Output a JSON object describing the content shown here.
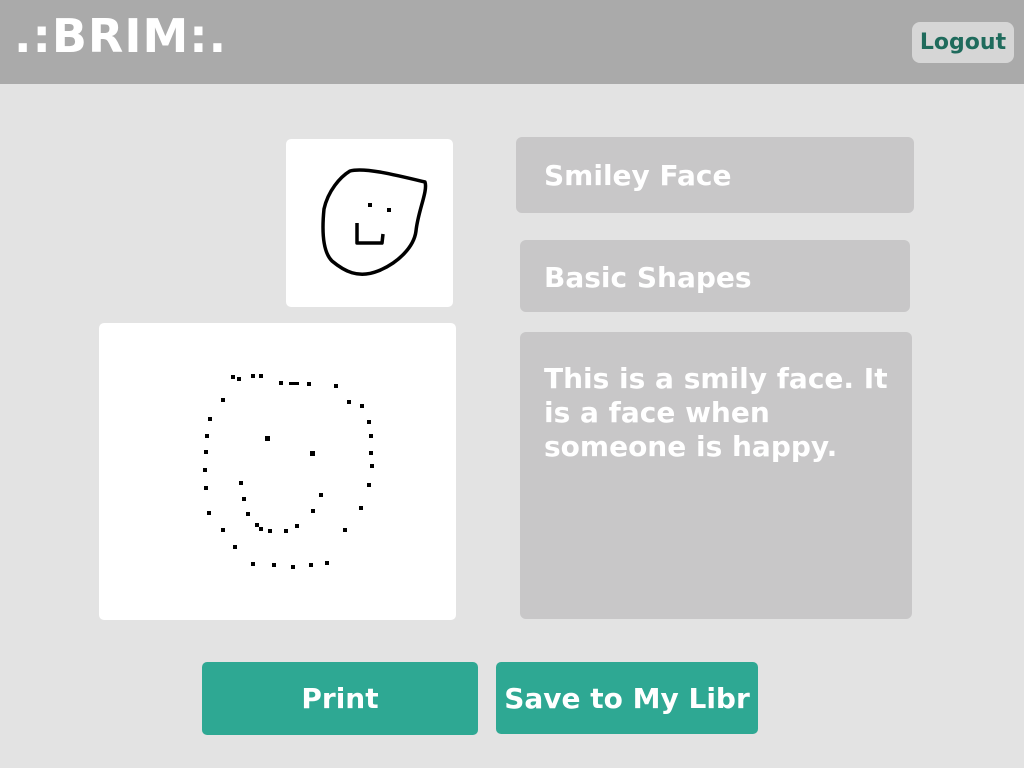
{
  "header": {
    "logo": ".:BRIM:.",
    "logout_label": "Logout"
  },
  "drawing": {
    "title": "Smiley Face",
    "category": "Basic Shapes",
    "description": "This is a smily face. It is a face when someone is happy."
  },
  "actions": {
    "print_label": "Print",
    "save_label": "Save to My Libr"
  },
  "colors": {
    "header_bg": "#aaaaaa",
    "page_bg": "#e3e3e3",
    "field_bg": "#c8c7c8",
    "accent": "#2ea893",
    "logout_text": "#1f6b5c"
  }
}
